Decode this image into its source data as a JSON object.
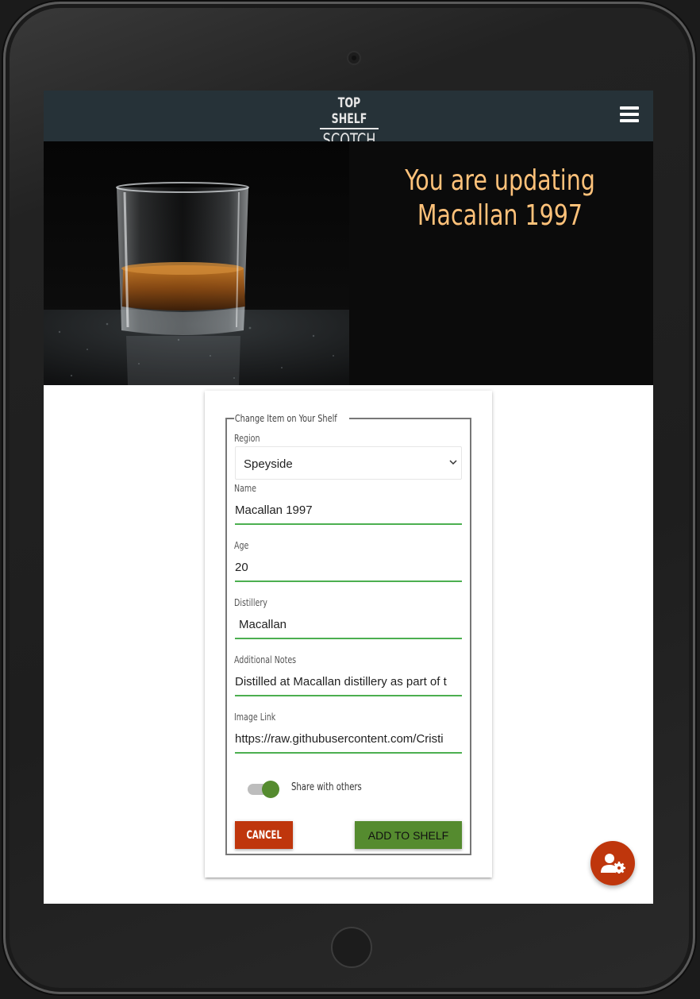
{
  "header": {
    "logo_line1": "TOP SHELF",
    "logo_line2": "SCOTCH",
    "menu_icon": "hamburger-menu-icon"
  },
  "hero": {
    "title": "You are updating Macallan 1997",
    "image": "whisky-glass-photo"
  },
  "form": {
    "legend": "Change Item on Your Shelf",
    "region": {
      "label": "Region",
      "value": "Speyside"
    },
    "name": {
      "label": "Name",
      "value": "Macallan 1997"
    },
    "age": {
      "label": "Age",
      "value": "20"
    },
    "distillery": {
      "label": "Distillery",
      "value": "Macallan"
    },
    "notes": {
      "label": "Additional Notes",
      "value": "Distilled at Macallan distillery as part of t"
    },
    "image_link": {
      "label": "Image Link",
      "value": "https://raw.githubusercontent.com/Cristi"
    },
    "share": {
      "label": "Share with others",
      "checked": true
    },
    "cancel_label": "CANCEL",
    "submit_label": "ADD TO SHELF"
  },
  "fab": {
    "icon": "user-settings-icon"
  },
  "colors": {
    "navbar": "#263238",
    "accent_orange": "#ffc27a",
    "cancel": "#bf360c",
    "submit": "#558b2f",
    "input_underline": "#4caf50"
  }
}
